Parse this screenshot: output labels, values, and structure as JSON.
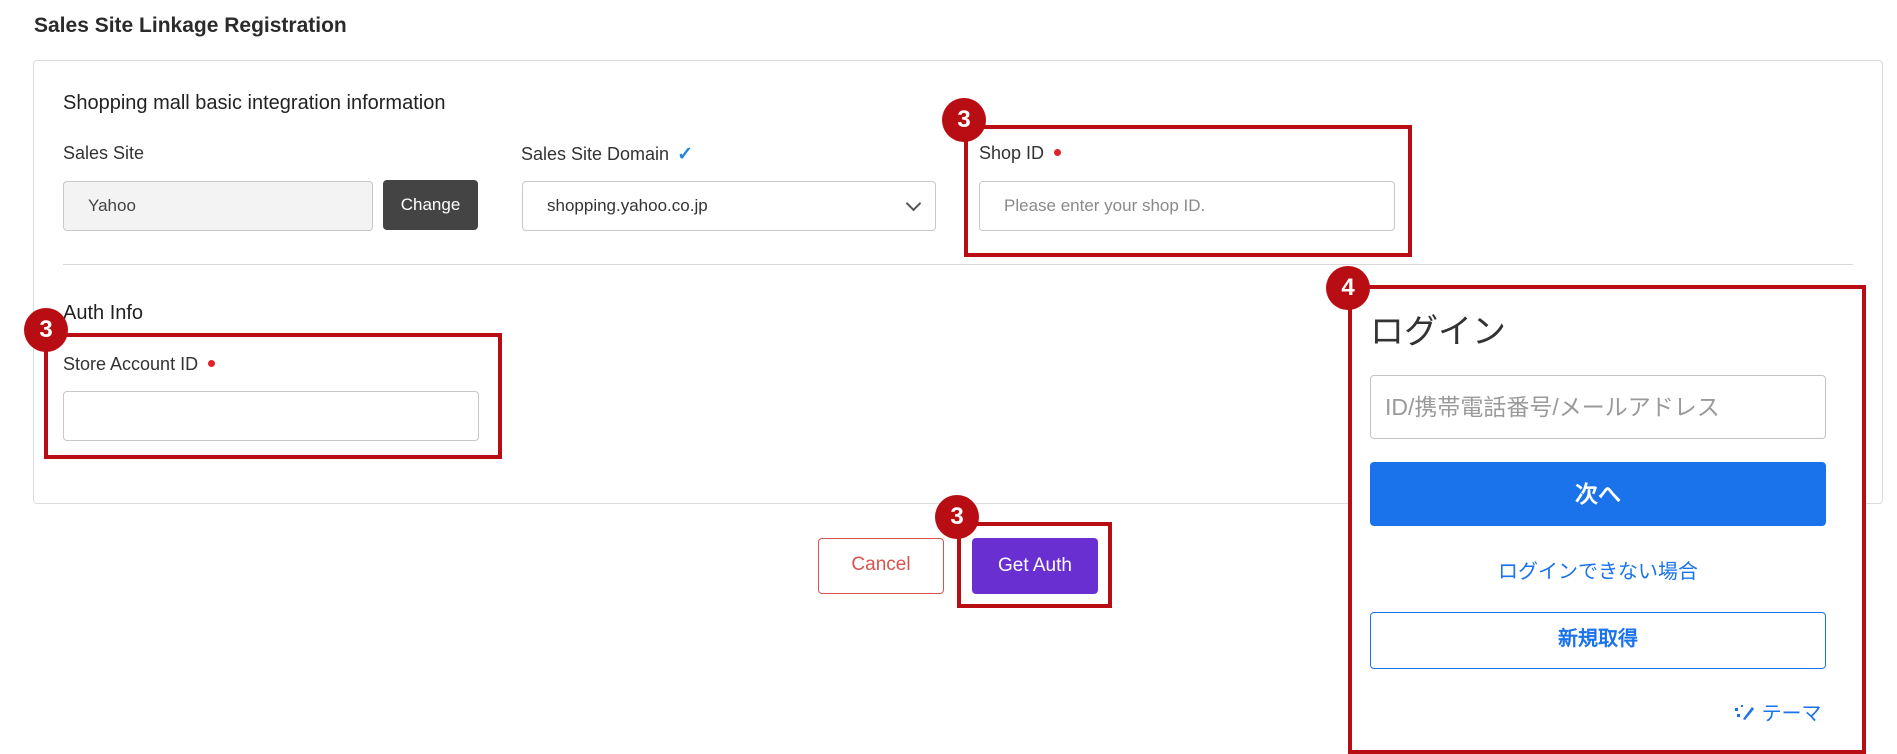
{
  "page": {
    "title": "Sales Site Linkage Registration"
  },
  "basic_info": {
    "section_title": "Shopping mall basic integration information",
    "sales_site": {
      "label": "Sales Site",
      "value": "Yahoo",
      "change_label": "Change"
    },
    "sales_site_domain": {
      "label": "Sales Site Domain",
      "check_icon": "✓",
      "value": "shopping.yahoo.co.jp"
    },
    "shop_id": {
      "label": "Shop ID",
      "placeholder": "Please enter your shop ID.",
      "value": ""
    }
  },
  "auth_info": {
    "section_title": "Auth Info",
    "store_account_id": {
      "label": "Store Account ID",
      "value": ""
    }
  },
  "actions": {
    "cancel_label": "Cancel",
    "get_auth_label": "Get Auth"
  },
  "callouts": {
    "shop_id": "3",
    "store_account": "3",
    "get_auth": "3",
    "login": "4"
  },
  "login": {
    "title": "ログイン",
    "input_placeholder": "ID/携帯電話番号/メールアドレス",
    "next_label": "次へ",
    "cant_login_link": "ログインできない場合",
    "signup_label": "新規取得",
    "theme_label": "テーマ"
  },
  "colors": {
    "callout_red": "#b80d12",
    "primary_purple": "#6a2fd0",
    "login_blue": "#1a73ea",
    "required_dot": "#e0242a"
  }
}
